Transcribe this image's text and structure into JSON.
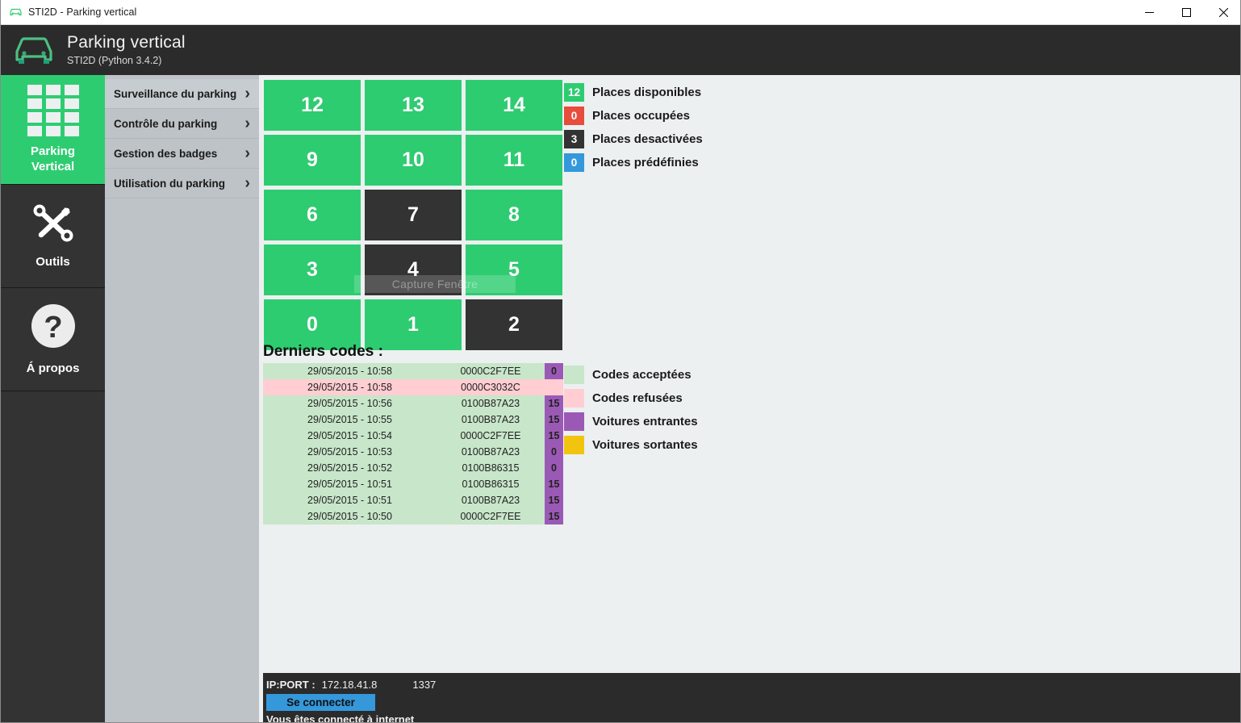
{
  "window": {
    "title": "STI2D - Parking vertical",
    "icon": "car-icon",
    "minimize_label": "—",
    "maximize_label": "☐",
    "close_label": "✕"
  },
  "header": {
    "logo": "car-icon",
    "title": "Parking vertical",
    "subtitle": "STI2D (Python 3.4.2)"
  },
  "rail": {
    "items": [
      {
        "id": "parking",
        "icon": "grid-icon",
        "label": "Parking\nVertical",
        "label_line1": "Parking",
        "label_line2": "Vertical",
        "active": true
      },
      {
        "id": "outils",
        "icon": "tools-icon",
        "label": "Outils",
        "active": false
      },
      {
        "id": "apropos",
        "icon": "question-mark-icon",
        "label": "Á propos",
        "active": false
      }
    ]
  },
  "submenu": {
    "items": [
      {
        "label": "Surveillance du parking",
        "chevron": "›",
        "highlighted": true
      },
      {
        "label": "Contrôle du parking",
        "chevron": "›",
        "highlighted": false
      },
      {
        "label": "Gestion des badges",
        "chevron": "›",
        "highlighted": false
      },
      {
        "label": "Utilisation du parking",
        "chevron": "›",
        "highlighted": false
      }
    ]
  },
  "parking_grid": {
    "rows": [
      [
        {
          "label": "12",
          "state": "free"
        },
        {
          "label": "13",
          "state": "free"
        },
        {
          "label": "14",
          "state": "free"
        }
      ],
      [
        {
          "label": "9",
          "state": "free"
        },
        {
          "label": "10",
          "state": "free"
        },
        {
          "label": "11",
          "state": "free"
        }
      ],
      [
        {
          "label": "6",
          "state": "free"
        },
        {
          "label": "7",
          "state": "disabled"
        },
        {
          "label": "8",
          "state": "free"
        }
      ],
      [
        {
          "label": "3",
          "state": "free"
        },
        {
          "label": "4",
          "state": "disabled"
        },
        {
          "label": "5",
          "state": "free"
        }
      ],
      [
        {
          "label": "0",
          "state": "free"
        },
        {
          "label": "1",
          "state": "free"
        },
        {
          "label": "2",
          "state": "disabled"
        }
      ]
    ]
  },
  "watermark": {
    "text": "Capture Fenêtre"
  },
  "status_legend": {
    "items": [
      {
        "count": "12",
        "label": "Places disponibles",
        "color": "#2ecc71"
      },
      {
        "count": "0",
        "label": "Places occupées",
        "color": "#e74c3c"
      },
      {
        "count": "3",
        "label": "Places desactivées",
        "color": "#333333"
      },
      {
        "count": "0",
        "label": "Places prédéfinies",
        "color": "#3498db"
      }
    ]
  },
  "codes": {
    "title": "Derniers codes :",
    "rows": [
      {
        "date": "29/05/2015 - 10:58",
        "code": "0000C2F7EE",
        "value": "0",
        "status": "accepted",
        "dir": "in"
      },
      {
        "date": "29/05/2015 - 10:58",
        "code": "0000C3032C",
        "value": "",
        "status": "refused",
        "dir": "none"
      },
      {
        "date": "29/05/2015 - 10:56",
        "code": "0100B87A23",
        "value": "15",
        "status": "accepted",
        "dir": "in"
      },
      {
        "date": "29/05/2015 - 10:55",
        "code": "0100B87A23",
        "value": "15",
        "status": "accepted",
        "dir": "in"
      },
      {
        "date": "29/05/2015 - 10:54",
        "code": "0000C2F7EE",
        "value": "15",
        "status": "accepted",
        "dir": "in"
      },
      {
        "date": "29/05/2015 - 10:53",
        "code": "0100B87A23",
        "value": "0",
        "status": "accepted",
        "dir": "in"
      },
      {
        "date": "29/05/2015 - 10:52",
        "code": "0100B86315",
        "value": "0",
        "status": "accepted",
        "dir": "in"
      },
      {
        "date": "29/05/2015 - 10:51",
        "code": "0100B86315",
        "value": "15",
        "status": "accepted",
        "dir": "in"
      },
      {
        "date": "29/05/2015 - 10:51",
        "code": "0100B87A23",
        "value": "15",
        "status": "accepted",
        "dir": "in"
      },
      {
        "date": "29/05/2015 - 10:50",
        "code": "0000C2F7EE",
        "value": "15",
        "status": "accepted",
        "dir": "in"
      }
    ]
  },
  "codes_legend": {
    "items": [
      {
        "label": "Codes acceptées",
        "color": "#c8e6c9"
      },
      {
        "label": "Codes refusées",
        "color": "#ffcdd2"
      },
      {
        "label": "Voitures entrantes",
        "color": "#9b59b6"
      },
      {
        "label": "Voitures sortantes",
        "color": "#f1c40f"
      }
    ]
  },
  "connection": {
    "ip_label": "IP:PORT :",
    "ip_value": "172.18.41.8",
    "port_value": "1337",
    "connect_button": "Se connecter",
    "status": "Vous êtes connecté à internet"
  }
}
